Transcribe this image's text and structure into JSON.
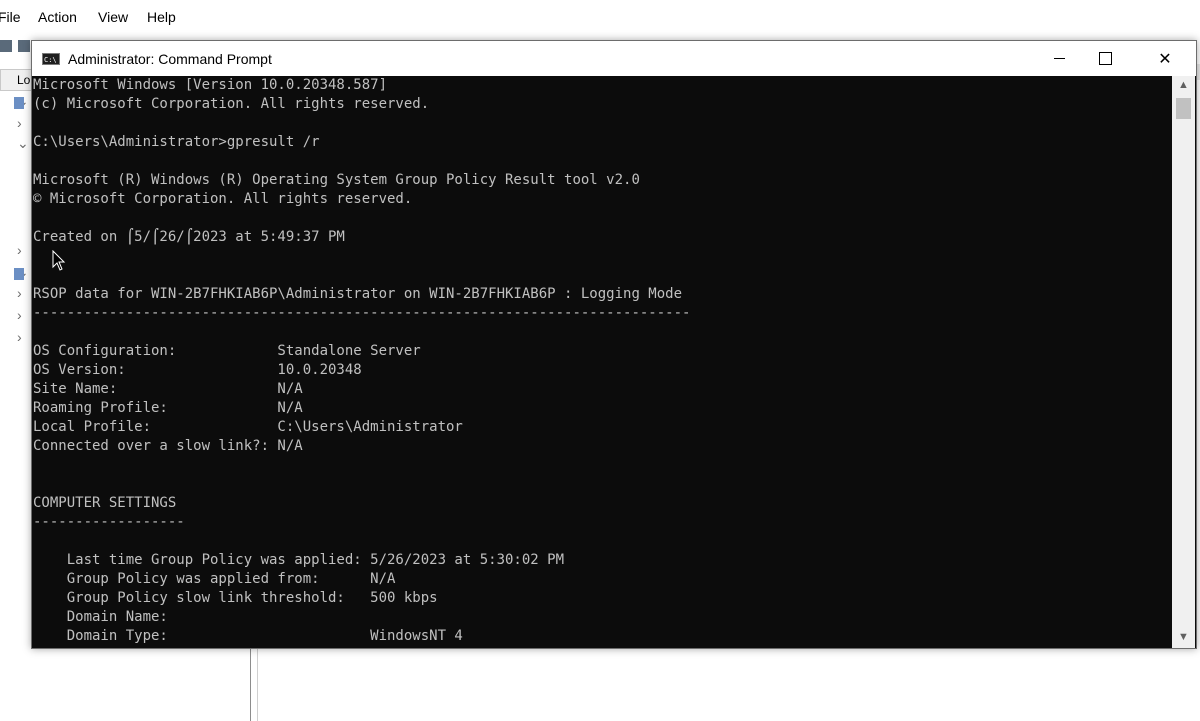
{
  "menubar": {
    "items": [
      "File",
      "Action",
      "View",
      "Help"
    ]
  },
  "tree": {
    "tab_label": "Lo"
  },
  "cmd": {
    "title": "Administrator: Command Prompt",
    "icon_label": "C:\\",
    "controls": {
      "minimize": "minimize-icon",
      "maximize": "maximize-icon",
      "close": "✕"
    },
    "lines": [
      "Microsoft Windows [Version 10.0.20348.587]",
      "(c) Microsoft Corporation. All rights reserved.",
      "",
      "C:\\Users\\Administrator>gpresult /r",
      "",
      "Microsoft (R) Windows (R) Operating System Group Policy Result tool v2.0",
      "© Microsoft Corporation. All rights reserved.",
      "",
      "Created on ⌠5/⌠26/⌠2023 at 5:49:37 PM",
      "",
      "",
      "RSOP data for WIN-2B7FHKIAB6P\\Administrator on WIN-2B7FHKIAB6P : Logging Mode",
      "------------------------------------------------------------------------------",
      "",
      "OS Configuration:            Standalone Server",
      "OS Version:                  10.0.20348",
      "Site Name:                   N/A",
      "Roaming Profile:             N/A",
      "Local Profile:               C:\\Users\\Administrator",
      "Connected over a slow link?: N/A",
      "",
      "",
      "COMPUTER SETTINGS",
      "------------------",
      "",
      "    Last time Group Policy was applied: 5/26/2023 at 5:30:02 PM",
      "    Group Policy was applied from:      N/A",
      "    Group Policy slow link threshold:   500 kbps",
      "    Domain Name:",
      "    Domain Type:                        WindowsNT 4"
    ]
  },
  "scrollbar": {
    "up": "▲",
    "down": "▼"
  }
}
